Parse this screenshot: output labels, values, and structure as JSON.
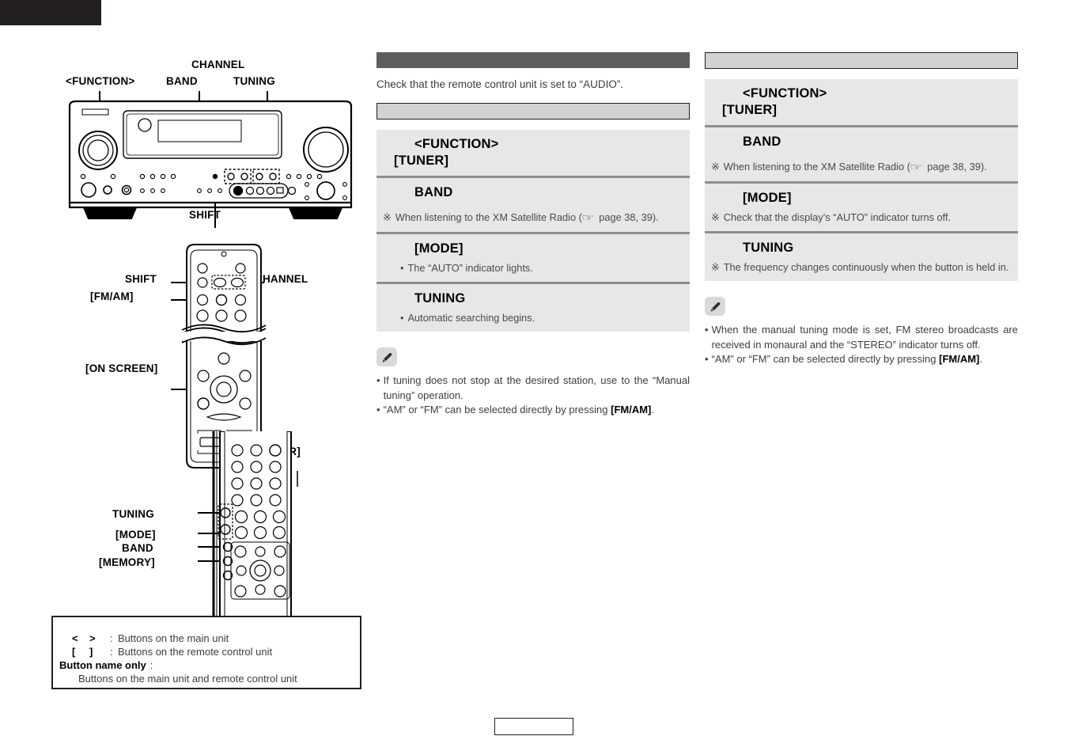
{
  "page": {
    "top_tab": "",
    "page_number": ""
  },
  "left_diagram": {
    "main_unit_labels": [
      {
        "id": "function",
        "text": "<FUNCTION>"
      },
      {
        "id": "band",
        "text": "BAND"
      },
      {
        "id": "channel",
        "text": "CHANNEL"
      },
      {
        "id": "tuning",
        "text": "TUNING"
      },
      {
        "id": "shift",
        "text": "SHIFT"
      }
    ],
    "remote_top_labels": [
      {
        "id": "shift",
        "text": "SHIFT"
      },
      {
        "id": "fm-am",
        "text": "[FM/AM]"
      },
      {
        "id": "channel",
        "text": "CHANNEL"
      },
      {
        "id": "on-screen",
        "text": "[ON SCREEN]"
      }
    ],
    "remote_bottom_labels": [
      {
        "id": "tuner",
        "text": "[TUNER]"
      },
      {
        "id": "tuning",
        "text": "TUNING"
      },
      {
        "id": "mode",
        "text": "[MODE]"
      },
      {
        "id": "band",
        "text": "BAND"
      },
      {
        "id": "memory",
        "text": "[MEMORY]"
      }
    ]
  },
  "legend": {
    "rows": [
      {
        "left": "<",
        "right": ">",
        "colon": ":",
        "text": "Buttons on the main unit"
      },
      {
        "left": "[",
        "right": "]",
        "colon": ":",
        "text": "Buttons on the remote control unit"
      }
    ],
    "name_only_label": "Button name only",
    "name_only_colon": ":",
    "name_only_text": "Buttons on the main unit and remote control unit"
  },
  "middle_column": {
    "header_bar": "",
    "intro": "Check that the remote control unit is set to “AUDIO”.",
    "subheader_bar": "",
    "steps": [
      {
        "title_main": "<FUNCTION>",
        "title_sub": "[TUNER]",
        "note": null,
        "note_marker": null
      },
      {
        "title_main": "BAND",
        "title_sub": null,
        "note_marker": "※",
        "note_pre": "When listening to the XM Satellite Radio (",
        "note_hand": "☞",
        "note_post": " page 38, 39)."
      },
      {
        "title_main": "[MODE]",
        "title_sub": null,
        "note_marker": "•",
        "note": "The “AUTO” indicator lights."
      },
      {
        "title_main": "TUNING",
        "title_sub": null,
        "note_marker": "•",
        "note": "Automatic searching begins."
      }
    ],
    "notes": [
      {
        "marker": "•",
        "text_pre": "If tuning does not stop at the desired station, use to the “Manual tuning” operation.",
        "bold": null,
        "text_post": null
      },
      {
        "marker": "•",
        "text_pre": "“AM” or “FM” can be selected directly by pressing ",
        "bold": "[FM/AM]",
        "text_post": "."
      }
    ]
  },
  "right_column": {
    "header_bar": "",
    "steps": [
      {
        "title_main": "<FUNCTION>",
        "title_sub": "[TUNER]",
        "note": null,
        "note_marker": null
      },
      {
        "title_main": "BAND",
        "title_sub": null,
        "note_marker": "※",
        "note_pre": "When listening to the XM Satellite Radio (",
        "note_hand": "☞",
        "note_post": " page 38, 39)."
      },
      {
        "title_main": "[MODE]",
        "title_sub": null,
        "note_marker": "※",
        "note": "Check that the display’s “AUTO” indicator turns off."
      },
      {
        "title_main": "TUNING",
        "title_sub": null,
        "note_marker": "※",
        "note": "The frequency changes continuously when the button is held in."
      }
    ],
    "notes": [
      {
        "marker": "•",
        "text_pre": "When the manual tuning mode is set, FM stereo broadcasts are received in monaural and the “STEREO” indicator turns off.",
        "bold": null,
        "text_post": null
      },
      {
        "marker": "•",
        "text_pre": "“AM” or “FM” can be selected directly by pressing ",
        "bold": "[FM/AM]",
        "text_post": "."
      }
    ]
  },
  "colors": {
    "dark_bar": "#5f5d5e",
    "light_bar": "#d2d2d2",
    "step_bg": "#e7e7e7",
    "step_divider": "#8e8e8e",
    "black": "#231f20"
  }
}
